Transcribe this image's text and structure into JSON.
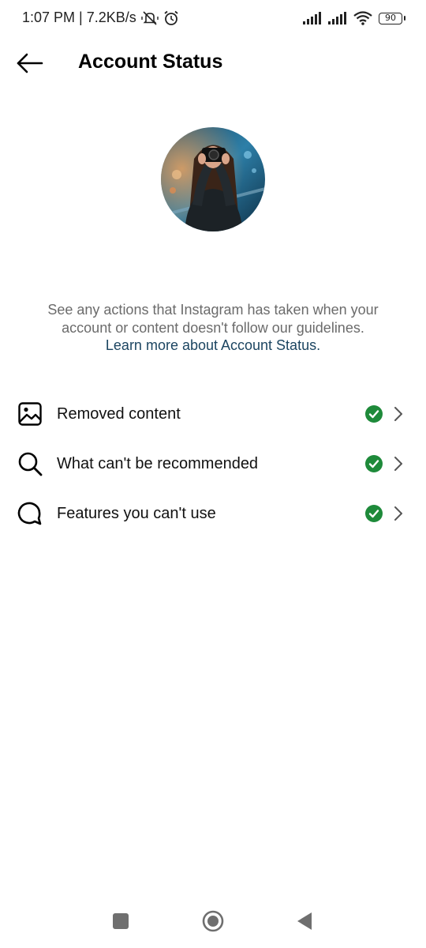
{
  "status_bar": {
    "time_speed": "1:07 PM | 7.2KB/s",
    "battery_level": "90",
    "icons": [
      "vibrate-off-icon",
      "alarm-icon",
      "signal-icon",
      "signal-icon",
      "wifi-icon",
      "battery-icon"
    ]
  },
  "header": {
    "title": "Account Status",
    "back_icon": "back-arrow-icon"
  },
  "description": {
    "text": "See any actions that Instagram has taken when your account or content doesn't follow our guidelines.",
    "link": "Learn more about Account Status."
  },
  "items": [
    {
      "label": "Removed content",
      "icon": "image-icon",
      "status": "ok"
    },
    {
      "label": "What can't be recommended",
      "icon": "search-icon",
      "status": "ok"
    },
    {
      "label": "Features you can't use",
      "icon": "chat-bubble-icon",
      "status": "ok"
    }
  ],
  "nav_bar": {
    "buttons": [
      "recents-button",
      "home-button",
      "back-button"
    ]
  },
  "colors": {
    "status_ok": "#1e8a3a",
    "link": "#1c4561",
    "secondary_text": "#6b6b6b"
  }
}
